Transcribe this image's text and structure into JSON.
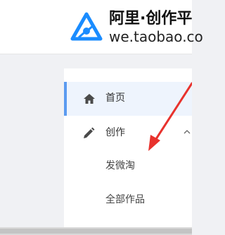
{
  "header": {
    "brand_title": "阿里·创作平",
    "brand_url": "we.taobao.co",
    "logo_icon": "alibaba-creator-logo-icon",
    "accent_color": "#1a8cff"
  },
  "sidebar": {
    "items": [
      {
        "label": "首页",
        "icon": "home-icon",
        "active": true
      },
      {
        "label": "创作",
        "icon": "pen-icon",
        "expanded": true
      },
      {
        "label": "发微淘",
        "sub": true
      },
      {
        "label": "全部作品",
        "sub": true
      }
    ],
    "active_color": "#5b9bf0"
  },
  "annotation": {
    "arrow_color": "#e8322d"
  }
}
